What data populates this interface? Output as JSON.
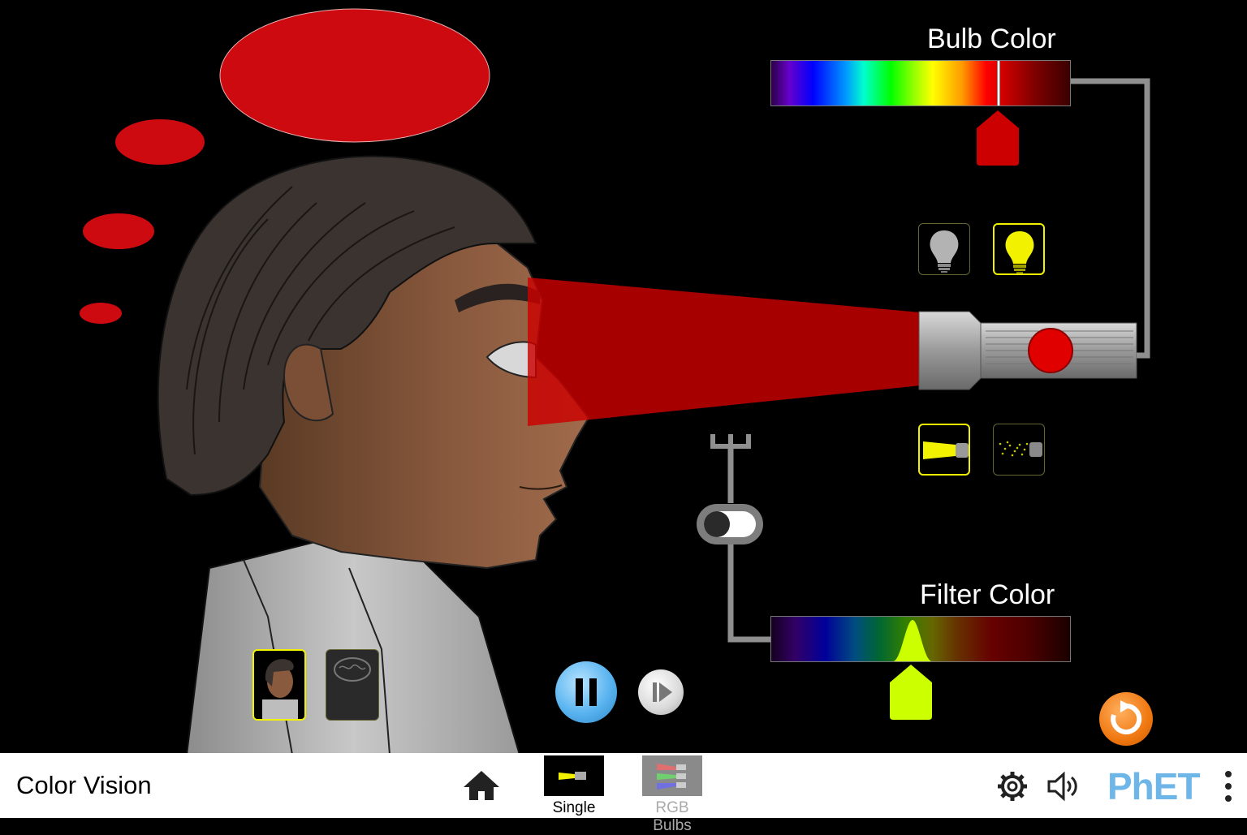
{
  "app": {
    "title": "Color Vision"
  },
  "bulb_slider": {
    "title": "Bulb Color",
    "thumb_color": "#cc0000",
    "wavelength_fraction": 0.76
  },
  "filter_slider": {
    "title": "Filter Color",
    "thumb_color": "#ccff00",
    "wavelength_fraction": 0.47
  },
  "beam": {
    "color": "#cc0000",
    "perceived_color": "#cc0000"
  },
  "bulb_options": [
    {
      "name": "white-light",
      "selected": false
    },
    {
      "name": "monochromatic-light",
      "selected": true
    }
  ],
  "beam_options": [
    {
      "name": "solid-beam",
      "selected": true
    },
    {
      "name": "photon-beam",
      "selected": false
    }
  ],
  "view_options": [
    {
      "name": "head-view",
      "selected": true
    },
    {
      "name": "brain-view",
      "selected": false
    }
  ],
  "filter_switch": {
    "on": false
  },
  "playback": {
    "playing": true
  },
  "screens": [
    {
      "label": "Single Bulb",
      "selected": true,
      "icon": "flashlight-icon"
    },
    {
      "label": "RGB Bulbs",
      "selected": false,
      "icon": "rgb-flashlights-icon"
    }
  ],
  "icons": {
    "home": "home-icon",
    "settings": "gear-icon",
    "sound": "speaker-icon",
    "menu": "kebab-menu-icon",
    "reset": "reset-icon"
  },
  "brand": {
    "logo_text": "PhET"
  }
}
